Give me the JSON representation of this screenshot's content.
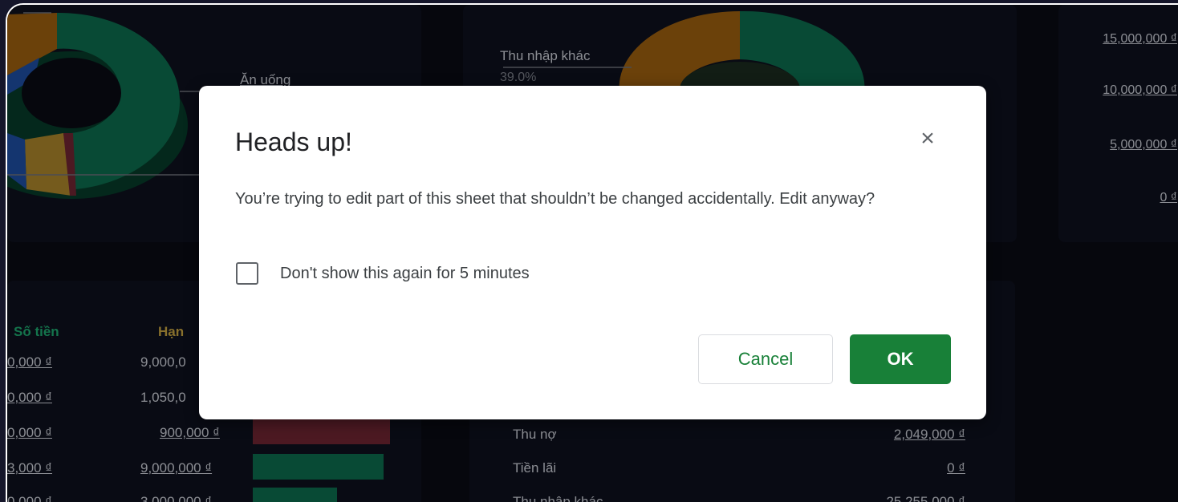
{
  "colors": {
    "green": "#0c6b4c",
    "orange": "#9a5e0f",
    "blue": "#1d4ca0",
    "gold": "#a8832a",
    "red": "#6e2431",
    "accent_button": "#188038"
  },
  "donut_left": {
    "label_an_uong": "Ăn uống"
  },
  "donut_mid": {
    "label": "Thu nhập khác",
    "percent": "39.0%"
  },
  "right_axis": {
    "ticks": [
      "15,000,000 ₫",
      "10,000,000 ₫",
      "5,000,000 ₫",
      "0 ₫"
    ]
  },
  "left_table": {
    "headers": [
      "Số tiền",
      "Hạn"
    ],
    "rows": [
      {
        "amount": "0,000 ₫",
        "limit": "9,000,0",
        "bar_fraction": null
      },
      {
        "amount": "0,000 ₫",
        "limit": "1,050,0",
        "bar_fraction": null
      },
      {
        "amount": "0,000 ₫",
        "limit": "900,000 ₫",
        "bar_color": "#6e2431",
        "bar_fraction": 1.0
      },
      {
        "amount": "3,000 ₫",
        "limit": "9,000,000 ₫",
        "bar_color": "#0c6b4c",
        "bar_fraction": 0.95
      },
      {
        "amount": "0,000 ₫",
        "limit": "3,000,000 ₫",
        "bar_color": "#0c6b4c",
        "bar_fraction": 0.6
      }
    ]
  },
  "mid_table": {
    "rows": [
      {
        "label": "Thu nợ",
        "value": "2,049,000 ₫"
      },
      {
        "label": "Tiền lãi",
        "value": "0 ₫"
      },
      {
        "label": "Thu nhập khác",
        "value": "25,255,000 ₫"
      }
    ]
  },
  "dialog": {
    "title": "Heads up!",
    "message": "You’re trying to edit part of this sheet that shouldn’t be changed accidentally. Edit anyway?",
    "checkbox_label": "Don't show this again for 5 minutes",
    "cancel_label": "Cancel",
    "ok_label": "OK",
    "close_icon": "close-icon",
    "close_glyph": "×"
  }
}
